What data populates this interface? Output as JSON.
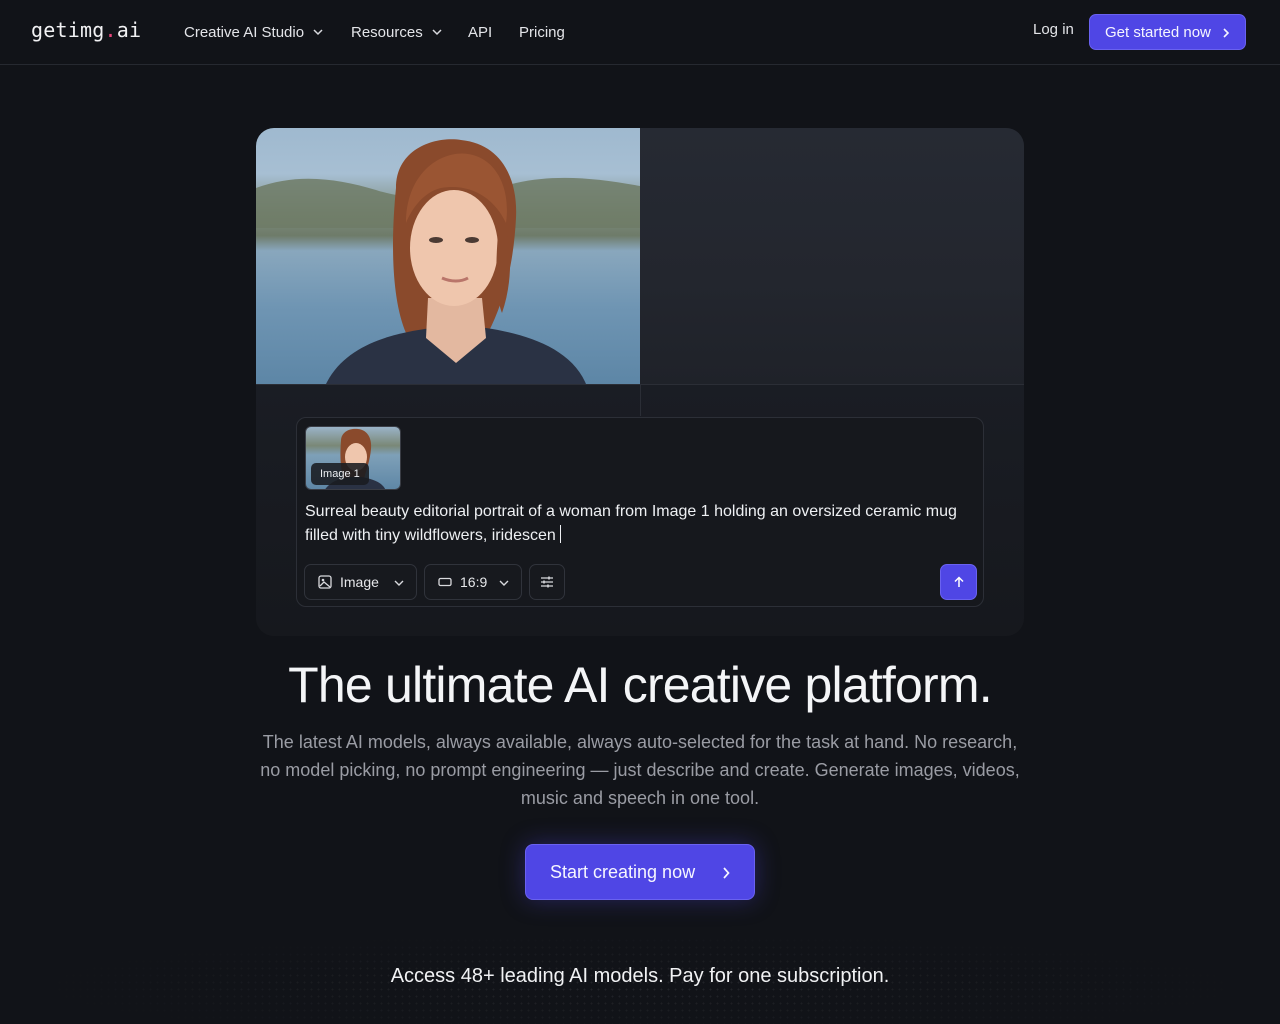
{
  "brand": {
    "logo_prefix": "getimg",
    "logo_dot": ".",
    "logo_suffix": "ai"
  },
  "nav": {
    "links": [
      {
        "label": "Creative AI Studio",
        "has_dropdown": true
      },
      {
        "label": "Resources",
        "has_dropdown": true
      },
      {
        "label": "API",
        "has_dropdown": false
      },
      {
        "label": "Pricing",
        "has_dropdown": false
      }
    ],
    "login": "Log in",
    "cta": "Get started now"
  },
  "prompt": {
    "attachment_label": "Image 1",
    "text": "Surreal beauty editorial portrait of a woman from Image 1 holding an oversized ceramic mug filled with tiny wildflowers, iridescen",
    "mode": "Image",
    "aspect_ratio": "16:9"
  },
  "hero": {
    "headline": "The ultimate AI creative platform.",
    "subtext": "The latest AI models, always available, always auto-selected for the task at hand. No research, no model picking, no prompt engineering — just describe and create. Generate images, videos, music and speech in one tool.",
    "cta": "Start creating now"
  },
  "access": {
    "text": "Access 48+ leading AI models. Pay for one subscription."
  },
  "colors": {
    "accent": "#4f46e5",
    "background": "#111318",
    "logo_dot": "#e8447a"
  }
}
